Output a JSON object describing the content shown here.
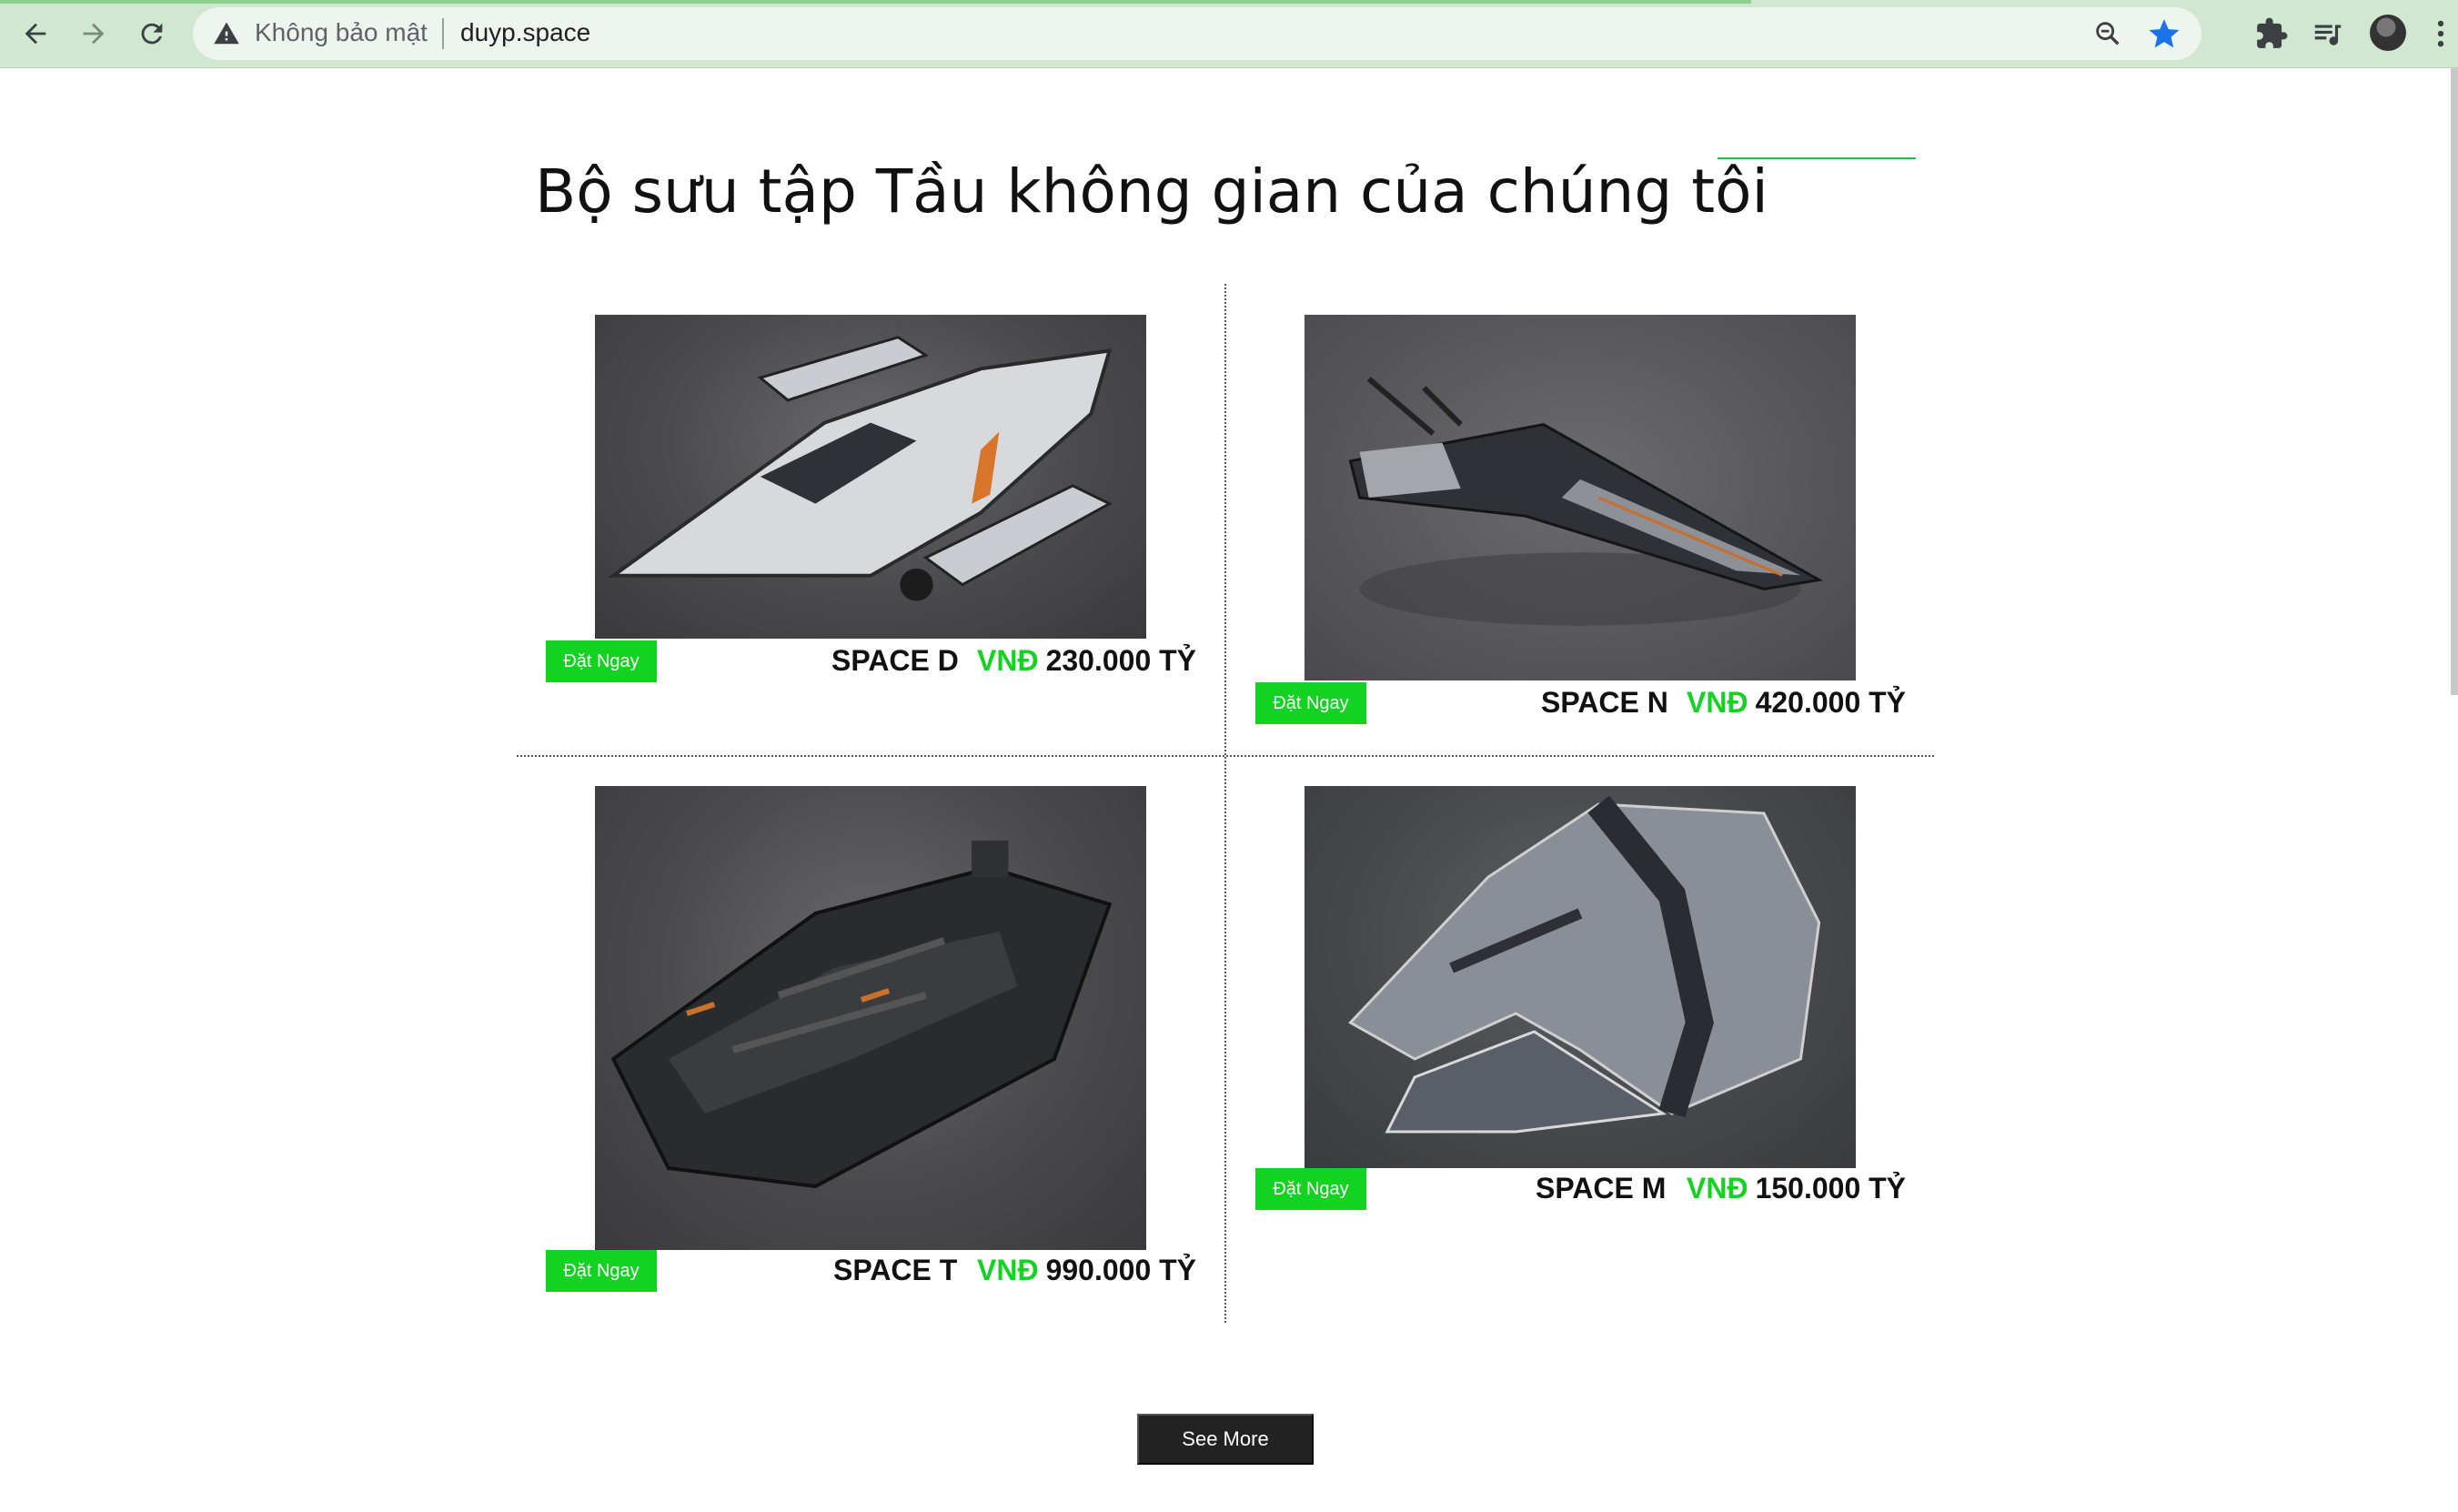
{
  "browser": {
    "security_label": "Không bảo mật",
    "url": "duyp.space",
    "icons": [
      "back-icon",
      "forward-icon",
      "reload-icon",
      "warning-icon",
      "zoom-icon",
      "bookmark-star-icon",
      "extensions-icon",
      "media-queue-icon",
      "profile-avatar",
      "menu-icon"
    ],
    "accent_color": "#1a73e8"
  },
  "page": {
    "title": "Bộ sưu tập Tầu không gian của chúng tôi",
    "accent_color": "#13d321",
    "products": [
      {
        "name": "SPACE D",
        "currency": "VNĐ",
        "price": "230.000 TỶ",
        "button": "Đặt Ngay"
      },
      {
        "name": "SPACE N",
        "currency": "VNĐ",
        "price": "420.000 TỶ",
        "button": "Đặt Ngay"
      },
      {
        "name": "SPACE T",
        "currency": "VNĐ",
        "price": "990.000 TỶ",
        "button": "Đặt Ngay"
      },
      {
        "name": "SPACE M",
        "currency": "VNĐ",
        "price": "150.000 TỶ",
        "button": "Đặt Ngay"
      }
    ],
    "see_more": "See More"
  }
}
